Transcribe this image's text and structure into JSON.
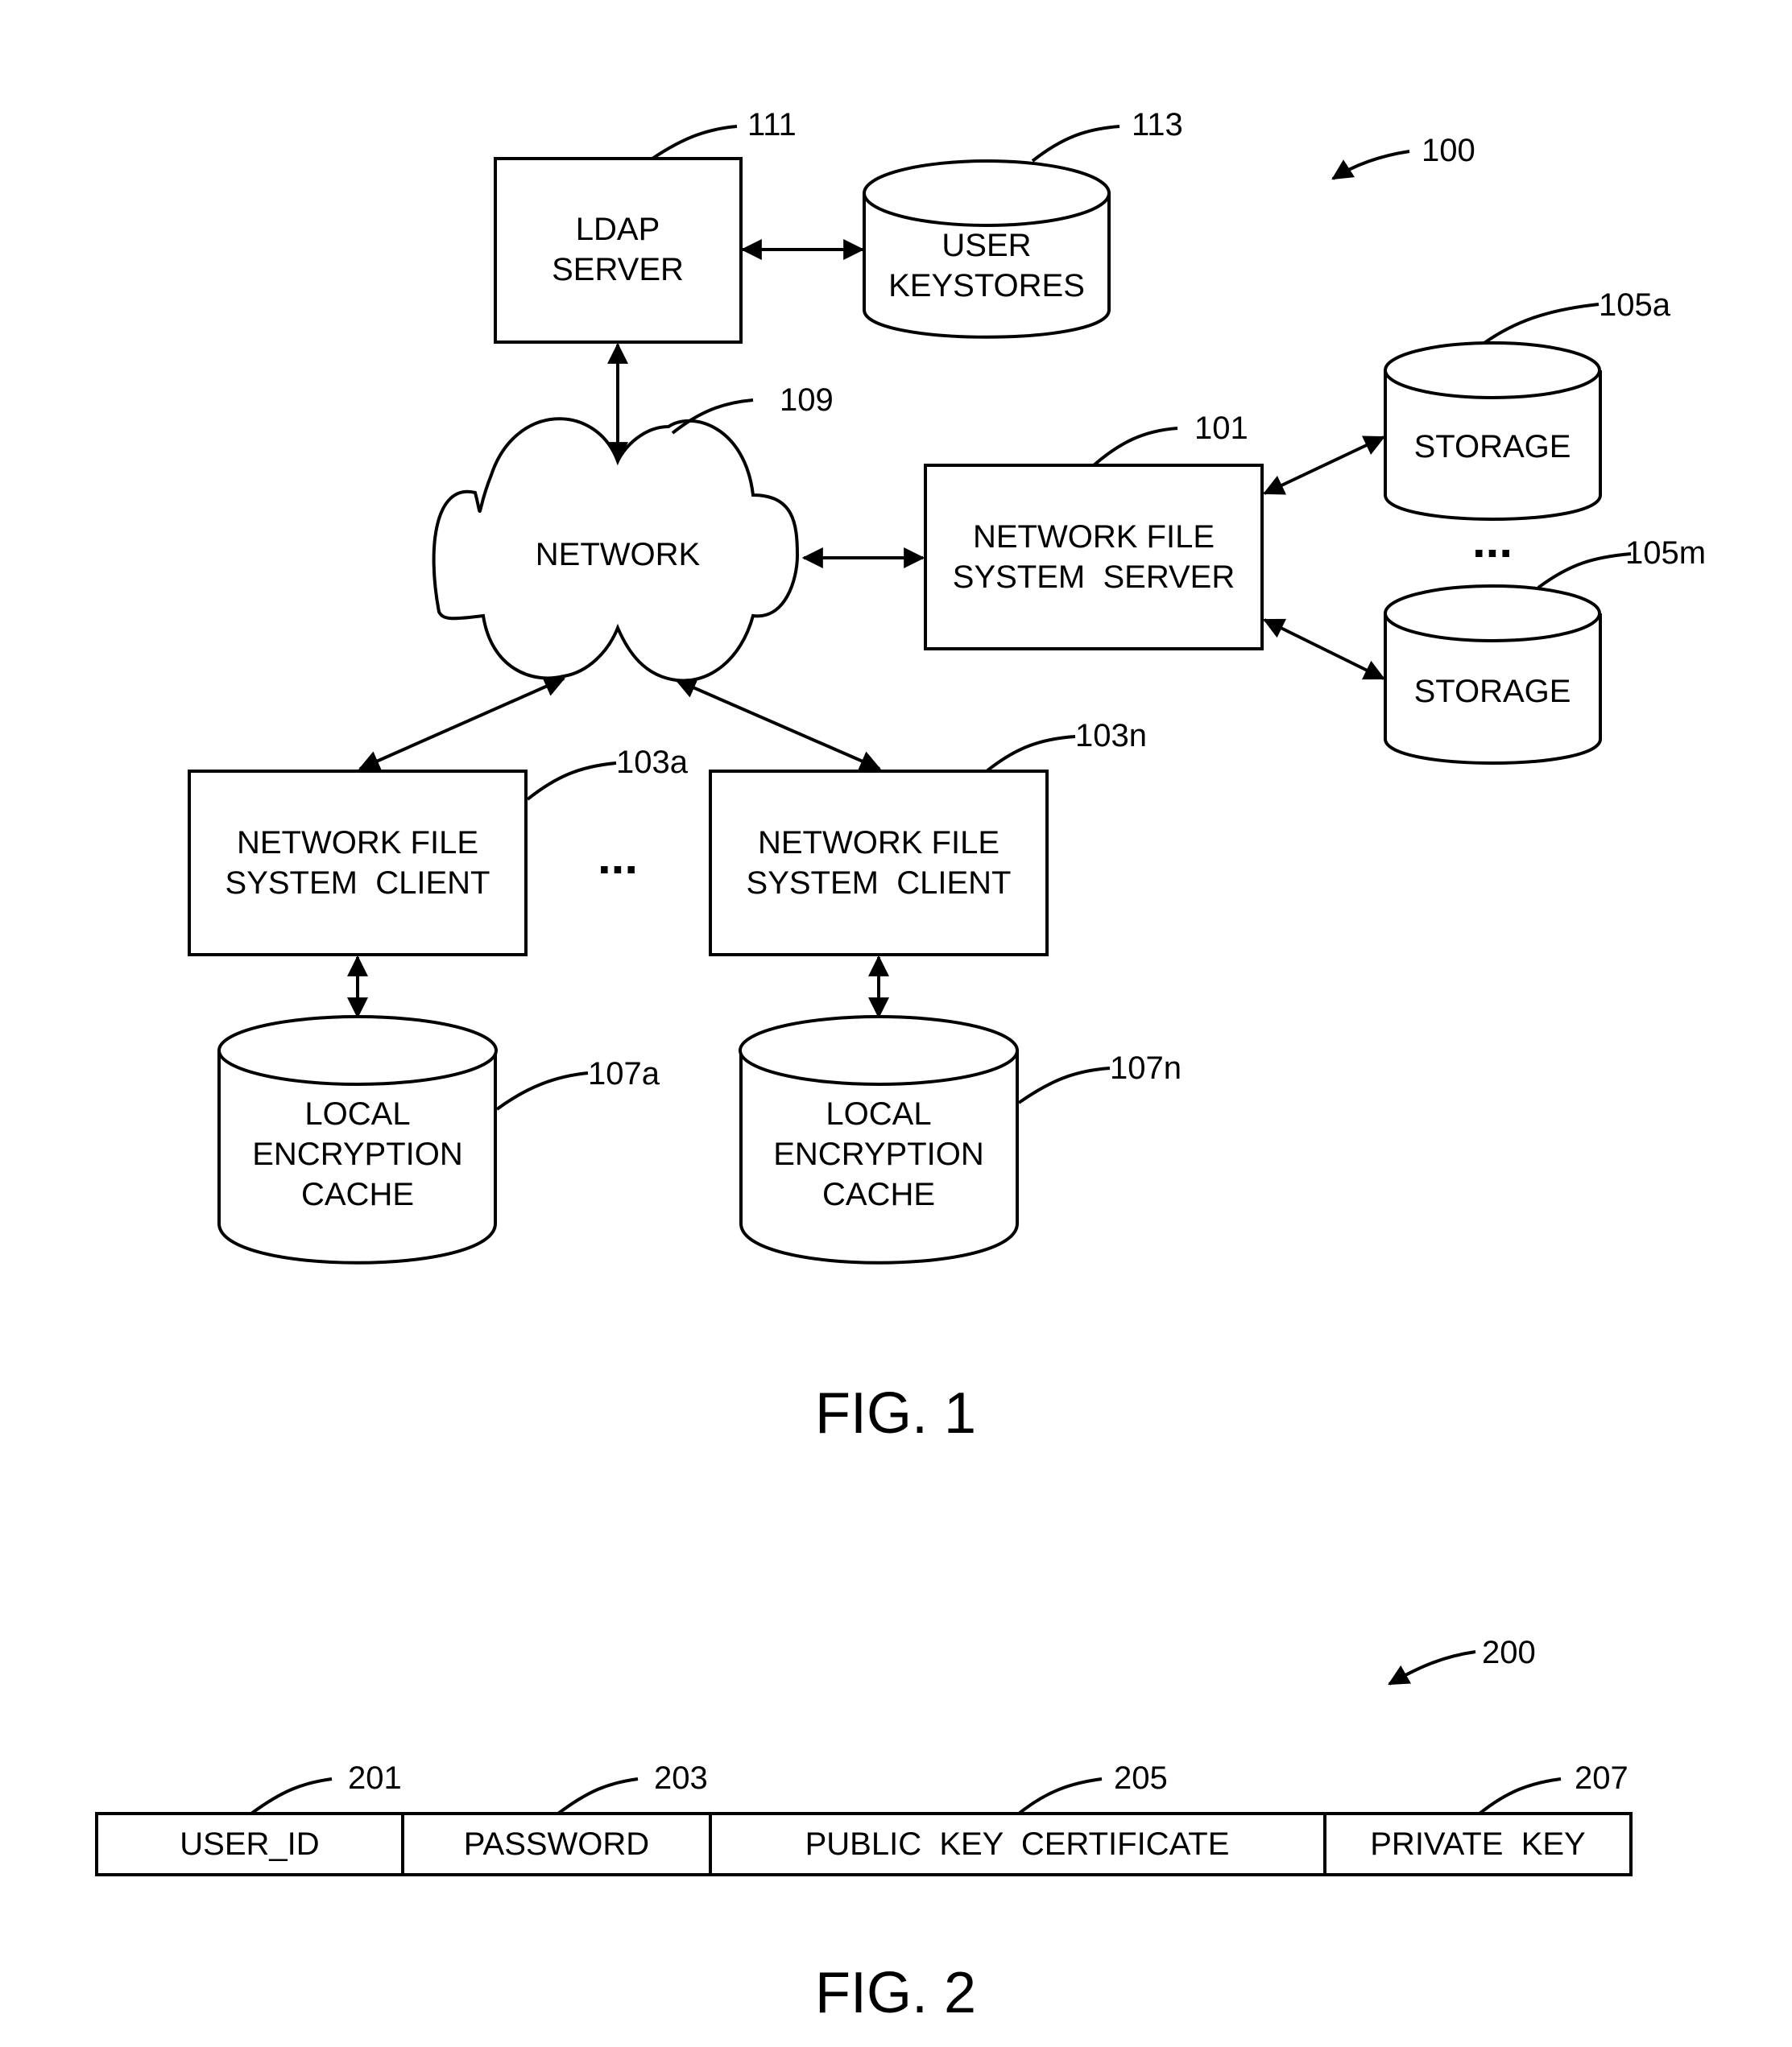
{
  "figure1": {
    "caption": "FIG. 1",
    "system_ref": "100",
    "ldap_server": {
      "lines": [
        "LDAP",
        "SERVER"
      ],
      "ref": "111"
    },
    "user_keystores": {
      "lines": [
        "USER",
        "KEYSTORES"
      ],
      "ref": "113"
    },
    "network": {
      "label": "NETWORK",
      "ref": "109"
    },
    "nfs_server": {
      "lines": [
        "NETWORK FILE",
        "SYSTEM  SERVER"
      ],
      "ref": "101"
    },
    "storage_a": {
      "label": "STORAGE",
      "ref": "105a"
    },
    "storage_m": {
      "label": "STORAGE",
      "ref": "105m"
    },
    "storage_ellipsis": "...",
    "client_a": {
      "lines": [
        "NETWORK FILE",
        "SYSTEM  CLIENT"
      ],
      "ref": "103a"
    },
    "client_n": {
      "lines": [
        "NETWORK FILE",
        "SYSTEM  CLIENT"
      ],
      "ref": "103n"
    },
    "client_ellipsis": "...",
    "cache_a": {
      "lines": [
        "LOCAL",
        "ENCRYPTION",
        "CACHE"
      ],
      "ref": "107a"
    },
    "cache_n": {
      "lines": [
        "LOCAL",
        "ENCRYPTION",
        "CACHE"
      ],
      "ref": "107n"
    }
  },
  "figure2": {
    "caption": "FIG. 2",
    "record_ref": "200",
    "fields": [
      {
        "label": "USER_ID",
        "ref": "201"
      },
      {
        "label": "PASSWORD",
        "ref": "203"
      },
      {
        "label": "PUBLIC  KEY  CERTIFICATE",
        "ref": "205"
      },
      {
        "label": "PRIVATE  KEY",
        "ref": "207"
      }
    ]
  }
}
